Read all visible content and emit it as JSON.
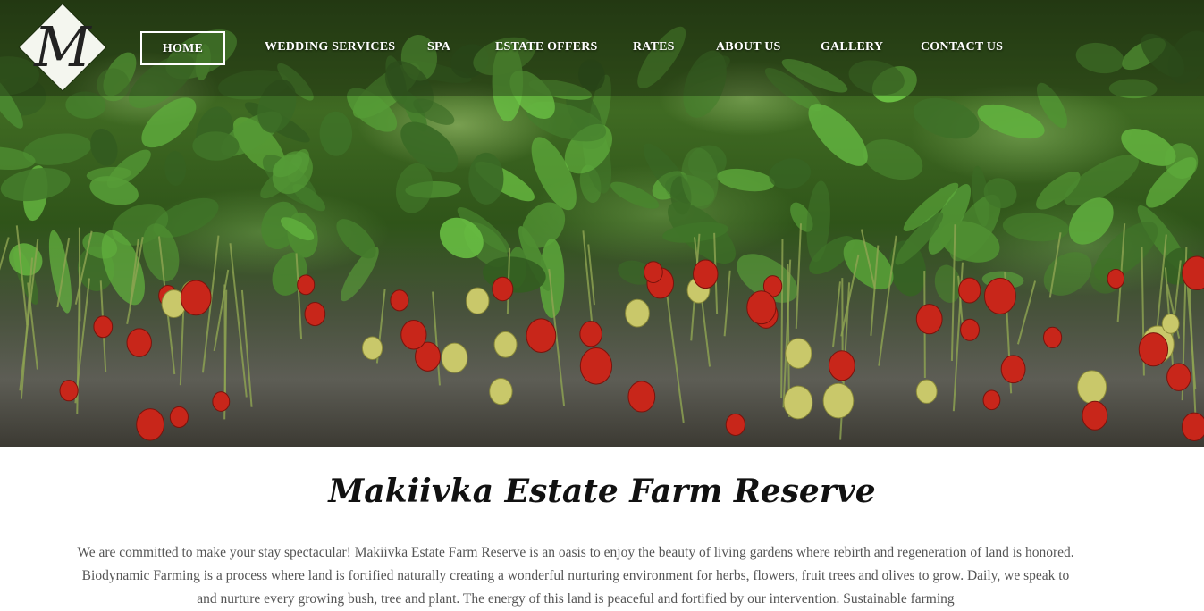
{
  "logo": {
    "letter": "M",
    "name": "logo-monogram"
  },
  "nav": {
    "items": [
      {
        "label": "HOME",
        "active": true
      },
      {
        "label": "WEDDING SERVICES",
        "active": false
      },
      {
        "label": "SPA",
        "active": false
      },
      {
        "label": "ESTATE OFFERS",
        "active": false
      },
      {
        "label": "RATES",
        "active": false
      },
      {
        "label": "ABOUT US",
        "active": false
      },
      {
        "label": "GALLERY",
        "active": false
      },
      {
        "label": "CONTACT US",
        "active": false
      }
    ]
  },
  "hero": {
    "image": "strawberry-plants-photo"
  },
  "main": {
    "title": "Makiivka Estate Farm Reserve",
    "intro": "We are committed to make your stay spectacular! Makiivka Estate Farm Reserve is an oasis to enjoy the beauty of living gardens where rebirth and regeneration of land is honored. Biodynamic Farming is a process where land is fortified naturally creating a wonderful nurturing environment for herbs, flowers, fruit trees and olives to grow. Daily, we speak to and nurture every growing bush, tree and plant. The energy of this land is peaceful and fortified by our intervention. Sustainable farming"
  },
  "colors": {
    "nav_text": "#ffffff",
    "title_text": "#111111",
    "body_text": "#555555",
    "strawberry_red": "#c8261a"
  }
}
